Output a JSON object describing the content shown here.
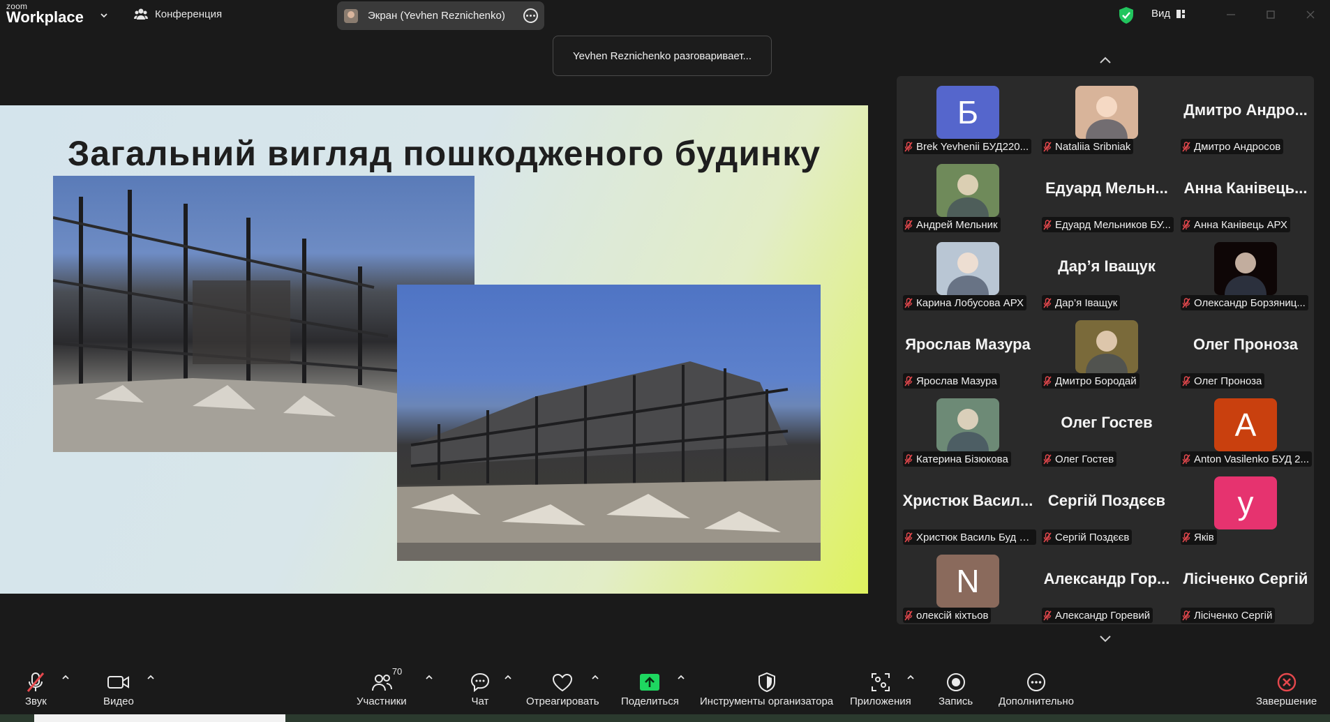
{
  "app": {
    "logo_line1": "zoom",
    "logo_line2": "Workplace"
  },
  "topbar": {
    "meeting_label": "Конференция",
    "screen_tab_label": "Экран (Yevhen Reznichenko)",
    "view_label": "Вид",
    "security_color": "#22c55e"
  },
  "banner": {
    "talking": "Yevhen Reznichenko разговаривает..."
  },
  "slide": {
    "title": "Загальний вигляд пошкодженого будинку"
  },
  "participants": [
    {
      "name": "Brek Yevhenii БУД220...",
      "avatar_type": "letter",
      "avatar_letter": "Б",
      "avatar_color": "#5566cc"
    },
    {
      "name": "Nataliia Sribniak",
      "avatar_type": "photo",
      "avatar_color": "#d8b49a"
    },
    {
      "name": "Дмитро Андросов",
      "avatar_type": "name",
      "big_name": "Дмитро Андро..."
    },
    {
      "name": "Андрей Мельник",
      "avatar_type": "photo",
      "avatar_color": "#6f8a5a"
    },
    {
      "name": "Едуард Мельников БУ...",
      "avatar_type": "name",
      "big_name": "Едуард Мельн..."
    },
    {
      "name": "Анна Канівець АРХ",
      "avatar_type": "name",
      "big_name": "Анна Канівець..."
    },
    {
      "name": "Карина Лобусова АРХ",
      "avatar_type": "photo",
      "avatar_color": "#b9c6d4"
    },
    {
      "name": "Дар’я Іващук",
      "avatar_type": "name",
      "big_name": "Дар’я Іващук"
    },
    {
      "name": "Олександр Борзяниц...",
      "avatar_type": "photo",
      "avatar_color": "#0e0606"
    },
    {
      "name": "Ярослав Мазура",
      "avatar_type": "name",
      "big_name": "Ярослав Мазура"
    },
    {
      "name": "Дмитро Бородай",
      "avatar_type": "photo",
      "avatar_color": "#7a6a3a"
    },
    {
      "name": "Олег Проноза",
      "avatar_type": "name",
      "big_name": "Олег Проноза"
    },
    {
      "name": "Катерина Бізюкова",
      "avatar_type": "photo",
      "avatar_color": "#6d8a76"
    },
    {
      "name": "Олег Гостев",
      "avatar_type": "name",
      "big_name": "Олег Гостев"
    },
    {
      "name": "Anton Vasilenko БУД 2...",
      "avatar_type": "letter",
      "avatar_letter": "A",
      "avatar_color": "#c9400e"
    },
    {
      "name": "Христюк Василь Буд 2...",
      "avatar_type": "name",
      "big_name": "Христюк Васил..."
    },
    {
      "name": "Сергій Поздєєв",
      "avatar_type": "name",
      "big_name": "Сергій Поздєєв"
    },
    {
      "name": "Яків",
      "avatar_type": "letter",
      "avatar_letter": "у",
      "avatar_color": "#e6336f"
    },
    {
      "name": "олексій кіхтьов",
      "avatar_type": "letter",
      "avatar_letter": "N",
      "avatar_color": "#8a6a5c"
    },
    {
      "name": "Александр Горевий",
      "avatar_type": "name",
      "big_name": "Александр Гор..."
    },
    {
      "name": "Лісіченко Сергій",
      "avatar_type": "name",
      "big_name": "Лісіченко Сергій"
    }
  ],
  "toolbar": {
    "audio": "Звук",
    "video": "Видео",
    "participants": "Участники",
    "participants_count": "70",
    "chat": "Чат",
    "react": "Отреагировать",
    "share": "Поделиться",
    "host_tools": "Инструменты организатора",
    "apps": "Приложения",
    "record": "Запись",
    "more": "Дополнительно",
    "end": "Завершение",
    "share_color": "#1ed760",
    "end_color": "#e5484d"
  }
}
